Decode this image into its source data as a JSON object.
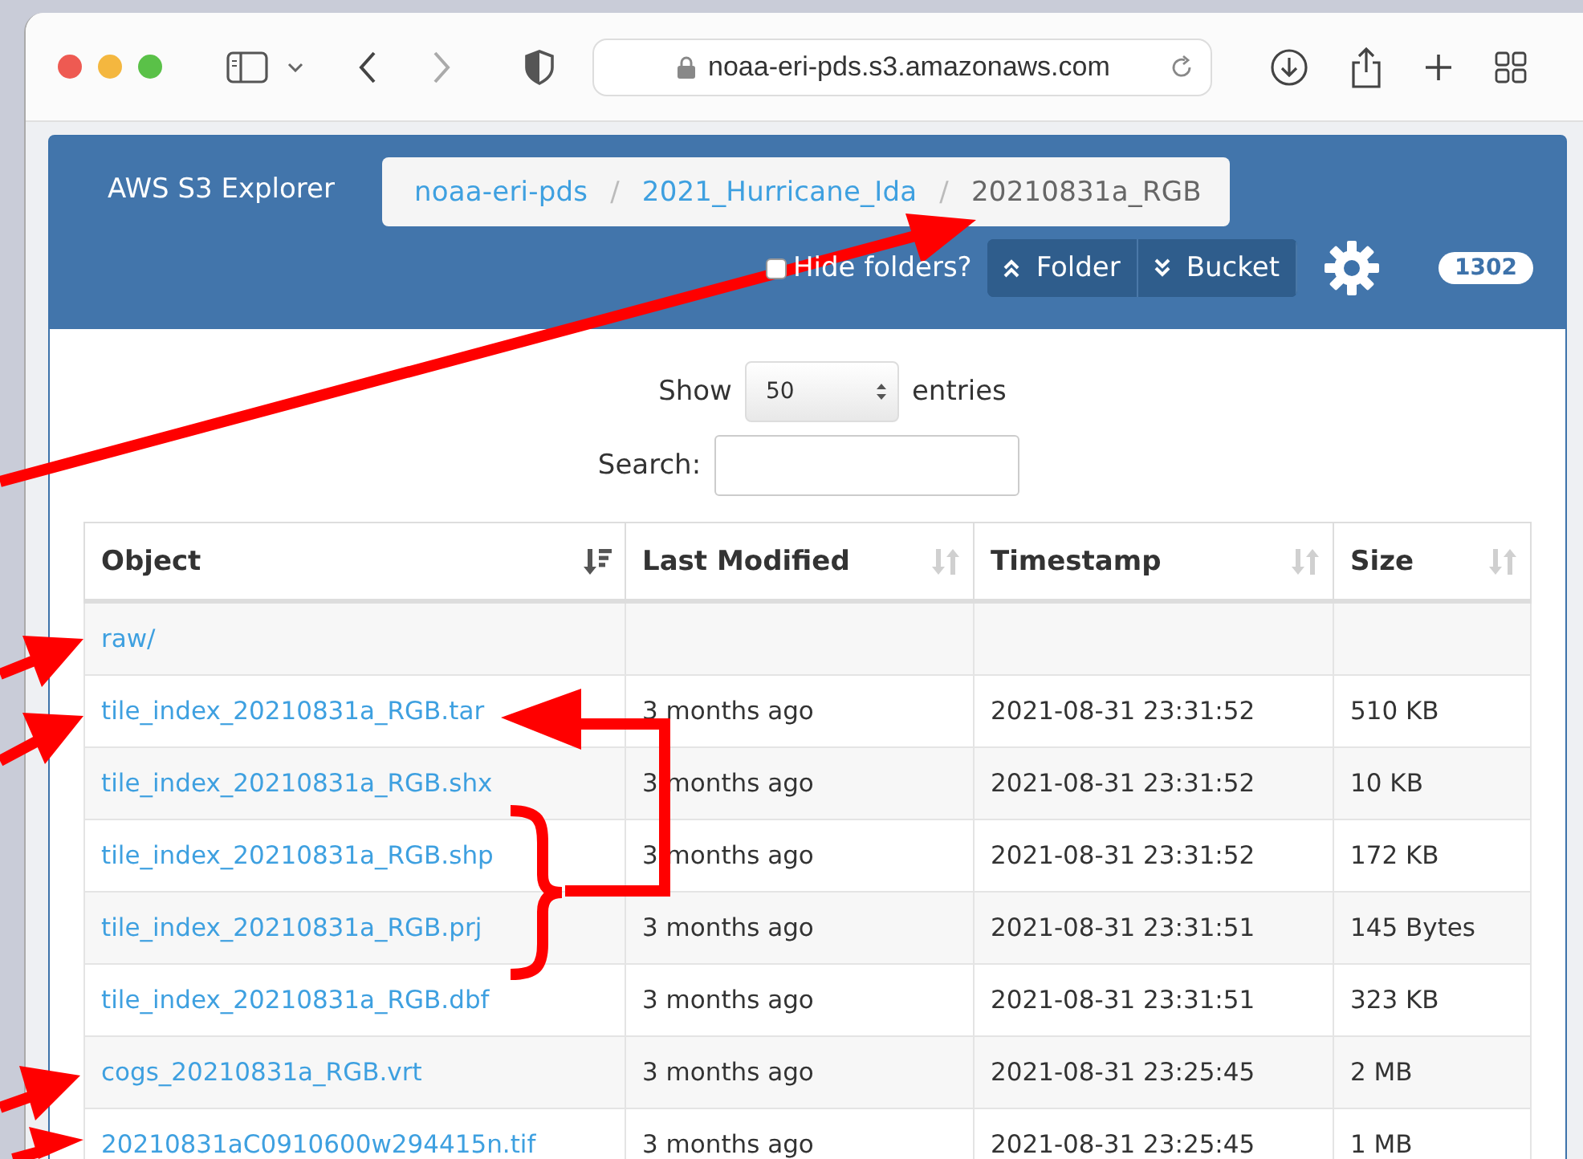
{
  "browser": {
    "url": "noaa-eri-pds.s3.amazonaws.com"
  },
  "header": {
    "title": "AWS S3 Explorer",
    "separator": "/",
    "breadcrumbs": [
      {
        "label": "noaa-eri-pds",
        "current": false
      },
      {
        "label": "2021_Hurricane_Ida",
        "current": false
      },
      {
        "label": "20210831a_RGB",
        "current": true
      }
    ],
    "hide_folders": {
      "label": "Hide folders?",
      "checked": false
    },
    "scope_buttons": [
      {
        "label": "Folder",
        "kind": "up"
      },
      {
        "label": "Bucket",
        "kind": "down"
      }
    ],
    "count": "1302"
  },
  "length": {
    "label_before": "Show",
    "value": "50",
    "label_after": "entries"
  },
  "search": {
    "label": "Search:"
  },
  "table": {
    "columns": [
      {
        "label": "Object",
        "sorted": true
      },
      {
        "label": "Last Modified",
        "sorted": false
      },
      {
        "label": "Timestamp",
        "sorted": false
      },
      {
        "label": "Size",
        "sorted": false
      }
    ],
    "rows": [
      {
        "object": "raw/"
      },
      {
        "object": "tile_index_20210831a_RGB.tar",
        "last_modified": "3 months ago",
        "timestamp": "2021-08-31 23:31:52",
        "size": "510 KB"
      },
      {
        "object": "tile_index_20210831a_RGB.shx",
        "last_modified": "3 months ago",
        "timestamp": "2021-08-31 23:31:52",
        "size": "10 KB"
      },
      {
        "object": "tile_index_20210831a_RGB.shp",
        "last_modified": "3 months ago",
        "timestamp": "2021-08-31 23:31:52",
        "size": "172 KB"
      },
      {
        "object": "tile_index_20210831a_RGB.prj",
        "last_modified": "3 months ago",
        "timestamp": "2021-08-31 23:31:51",
        "size": "145 Bytes"
      },
      {
        "object": "tile_index_20210831a_RGB.dbf",
        "last_modified": "3 months ago",
        "timestamp": "2021-08-31 23:31:51",
        "size": "323 KB"
      },
      {
        "object": "cogs_20210831a_RGB.vrt",
        "last_modified": "3 months ago",
        "timestamp": "2021-08-31 23:25:45",
        "size": "2 MB"
      },
      {
        "object": "20210831aC0910600w294415n.tif",
        "last_modified": "3 months ago",
        "timestamp": "2021-08-31 23:25:45",
        "size": "1 MB"
      }
    ]
  }
}
